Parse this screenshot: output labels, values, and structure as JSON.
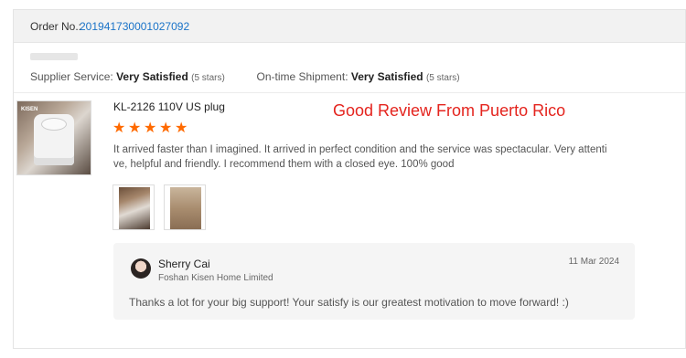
{
  "order": {
    "label": "Order No.:",
    "number": "201941730001027092"
  },
  "ratings": {
    "supplier_label": "Supplier Service:",
    "supplier_value": "Very Satisfied",
    "supplier_stars": "(5 stars)",
    "shipment_label": "On-time Shipment:",
    "shipment_value": "Very Satisfied",
    "shipment_stars": "(5 stars)"
  },
  "product": {
    "model": "KL-2126 110V US plug",
    "image_icon": "shampoo-chair-product-image",
    "rating": 5
  },
  "headline": "Good Review From Puerto Rico",
  "review": {
    "text": "It arrived faster than I imagined. It arrived in perfect condition and the service was spectacular. Very attentive, helpful and friendly. I recommend them with a closed eye. 100% good",
    "star_glyph": "★",
    "star_color": "#ff6a00"
  },
  "reply": {
    "name": "Sherry Cai",
    "company": "Foshan Kisen Home Limited",
    "date": "11 Mar 2024",
    "text": "Thanks a lot for your big support! Your satisfy is our greatest motivation to move forward! :)"
  },
  "colors": {
    "order_link": "#1a73c8",
    "headline": "#e4241e",
    "star": "#ff6a00"
  }
}
